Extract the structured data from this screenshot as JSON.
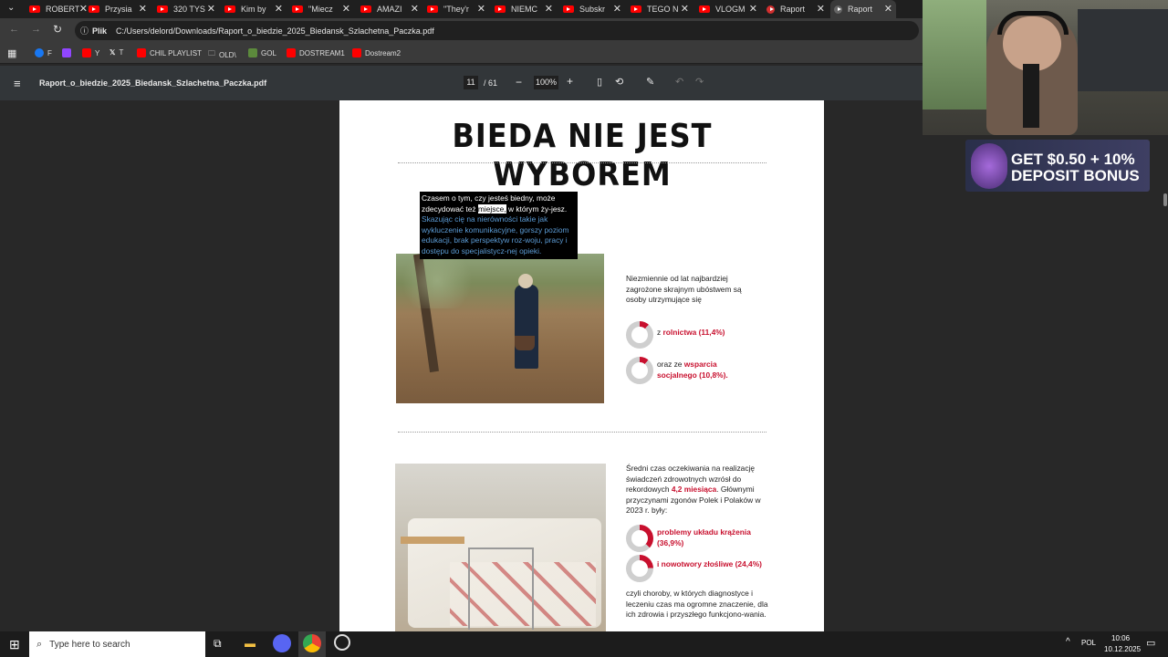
{
  "tabs": [
    {
      "label": "ROBERT"
    },
    {
      "label": "Przysia"
    },
    {
      "label": "320 TYS"
    },
    {
      "label": "Kim by"
    },
    {
      "label": "\"Miecz"
    },
    {
      "label": "AMAZI"
    },
    {
      "label": "\"They'r"
    },
    {
      "label": "NIEMC"
    },
    {
      "label": "Subskr"
    },
    {
      "label": "TEGO N"
    },
    {
      "label": "VLOGM"
    },
    {
      "label": "Raport"
    },
    {
      "label": "Raport"
    }
  ],
  "address": {
    "prefix": "Plik",
    "url": "C:/Users/delord/Downloads/Raport_o_biedzie_2025_Biedansk_Szlachetna_Paczka.pdf"
  },
  "bookmarks": [
    {
      "label": "F"
    },
    {
      "label": ""
    },
    {
      "label": "Y"
    },
    {
      "label": "T"
    },
    {
      "label": "CHIL PLAYLIST"
    },
    {
      "label": "OLD\\"
    },
    {
      "label": "GOL"
    },
    {
      "label": "DOSTREAM1"
    },
    {
      "label": "Dostream2"
    }
  ],
  "pdf": {
    "filename": "Raport_o_biedzie_2025_Biedansk_Szlachetna_Paczka.pdf",
    "page_current": "11",
    "page_total": "/ 61",
    "zoom": "100%"
  },
  "page": {
    "headline": "BIEDA NIE JEST WYBOREM",
    "quote_part1": "Czasem o tym, czy jesteś biedny, może zdecydować też ",
    "quote_highlight": "miejsce,",
    "quote_part2": " w którym ży-jesz. ",
    "quote_part3": "Skazując cię na nierówności takie jak wykluczenie komunikacyjne, gorszy poziom edukacji, brak perspektyw roz-woju, pracy i dostępu do specjalistycz-nej opieki.",
    "stat1_intro": "Niezmiennie od lat najbardziej zagrożone skrajnym ubóstwem są osoby utrzymujące się",
    "stat1_a_prefix": "z ",
    "stat1_a_value": "rolnictwa (11,4%)",
    "stat1_b_prefix": "oraz ze ",
    "stat1_b_value": "wsparcia socjalnego (10,8%).",
    "stat2_intro1": "Średni czas oczekiwania na realizację świadczeń zdrowotnych wzrósł do rekordowych ",
    "stat2_highlight": "4,2 miesiąca",
    "stat2_intro2": ". Głównymi przyczynami zgonów Polek i Polaków w 2023 r. były:",
    "stat2_a": "problemy układu krążenia (36,9%)",
    "stat2_b": "i nowotwory złośliwe (24,4%)",
    "stat2_outro": "czyli choroby, w których diagnostyce i leczeniu czas ma ogromne znaczenie, dla ich zdrowia i przyszłego funkcjono-wania.",
    "donut_values": {
      "rolnictwo": 11.4,
      "wsparcie": 10.8,
      "krazenie": 36.9,
      "nowotwory": 24.4
    }
  },
  "ad": {
    "line1": "GET $0.50 + 10%",
    "line2": "DEPOSIT BONUS"
  },
  "taskbar": {
    "search_placeholder": "Type here to search",
    "lang": "POL",
    "time": "10:06",
    "date": "10.12.2025"
  },
  "colors": {
    "accent_red": "#c8102e",
    "highlight_bg": "#000000",
    "highlight_text_blue": "#5b9bd5"
  }
}
